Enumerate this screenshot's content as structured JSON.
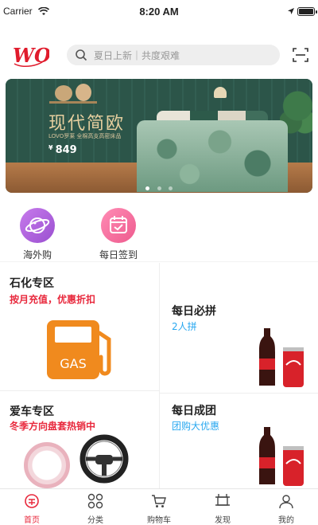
{
  "status_bar": {
    "carrier": "Carrier",
    "time": "8:20 AM"
  },
  "header": {
    "logo_text": "WO",
    "search_placeholder": "夏日上新｜共度艰难"
  },
  "banner": {
    "title": "现代简欧",
    "subtitle": "LOVO罗莱  全棉高支高密床品",
    "currency": "¥",
    "price": "849",
    "page_count": 3,
    "active_page": 1
  },
  "quick_links": [
    {
      "label": "海外购",
      "icon": "planet-icon",
      "color": "#b06ad9"
    },
    {
      "label": "每日签到",
      "icon": "calendar-check-icon",
      "color": "#f26a9b"
    }
  ],
  "promos": {
    "petro": {
      "title": "石化专区",
      "subtitle": "按月充值，优惠折扣",
      "image_text": "GAS"
    },
    "daily_group": {
      "title": "每日必拼",
      "subtitle": "2人拼"
    },
    "car": {
      "title": "爱车专区",
      "subtitle": "冬季方向盘套热销中"
    },
    "team": {
      "title": "每日成团",
      "subtitle": "团购大优惠"
    }
  },
  "tabbar": [
    {
      "label": "首页",
      "icon": "home-icon",
      "active": true
    },
    {
      "label": "分类",
      "icon": "category-icon",
      "active": false
    },
    {
      "label": "购物车",
      "icon": "cart-icon",
      "active": false
    },
    {
      "label": "发现",
      "icon": "discover-icon",
      "active": false
    },
    {
      "label": "我的",
      "icon": "user-icon",
      "active": false
    }
  ],
  "colors": {
    "accent_red": "#e8283c",
    "accent_blue": "#29a8f0",
    "gas_orange": "#f08a1e"
  }
}
